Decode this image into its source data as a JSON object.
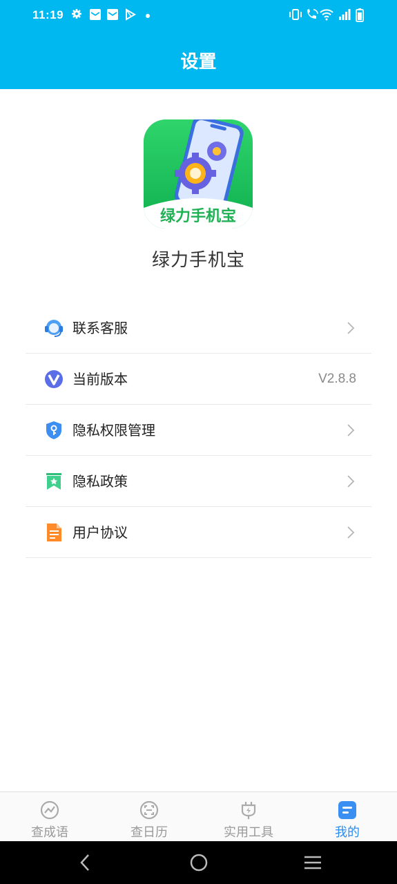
{
  "status_bar": {
    "time": "11:19",
    "left_icons": [
      "gear-icon",
      "mail-icon",
      "mail-icon",
      "play-store-icon",
      "dot-icon"
    ],
    "right_icons": [
      "vibrate-icon",
      "wifi-call-icon",
      "wifi-icon",
      "signal-icon",
      "battery-icon"
    ]
  },
  "header": {
    "title": "设置"
  },
  "app": {
    "logo_text": "绿力手机宝",
    "name": "绿力手机宝"
  },
  "menu": {
    "items": [
      {
        "label": "联系客服",
        "icon": "customer-service-icon",
        "value": ""
      },
      {
        "label": "当前版本",
        "icon": "version-icon",
        "value": "V2.8.8"
      },
      {
        "label": "隐私权限管理",
        "icon": "shield-icon",
        "value": ""
      },
      {
        "label": "隐私政策",
        "icon": "bookmark-icon",
        "value": ""
      },
      {
        "label": "用户协议",
        "icon": "document-icon",
        "value": ""
      }
    ]
  },
  "bottom_nav": {
    "tabs": [
      {
        "label": "查成语",
        "icon": "chart-circle-icon",
        "active": false
      },
      {
        "label": "查日历",
        "icon": "scan-face-icon",
        "active": false
      },
      {
        "label": "实用工具",
        "icon": "plug-icon",
        "active": false
      },
      {
        "label": "我的",
        "icon": "profile-card-icon",
        "active": true
      }
    ]
  },
  "colors": {
    "header_bg": "#00b8f0",
    "active_tab": "#2a8cf0",
    "logo_green": "#22c55e"
  }
}
